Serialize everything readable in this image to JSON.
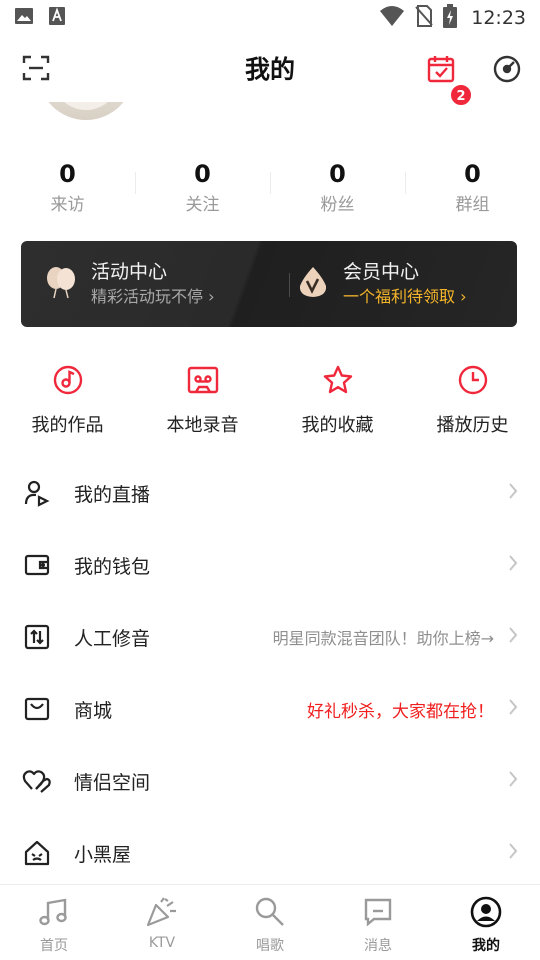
{
  "status_bar": {
    "time": "12:23"
  },
  "header": {
    "title": "我的",
    "calendar_badge": "2"
  },
  "stats": [
    {
      "value": "0",
      "label": "来访"
    },
    {
      "value": "0",
      "label": "关注"
    },
    {
      "value": "0",
      "label": "粉丝"
    },
    {
      "value": "0",
      "label": "群组"
    }
  ],
  "banner": {
    "activity": {
      "title": "活动中心",
      "subtitle": "精彩活动玩不停 ›"
    },
    "vip": {
      "title": "会员中心",
      "subtitle": "一个福利待领取 ›"
    }
  },
  "shortcuts": [
    {
      "label": "我的作品",
      "icon": "disc-icon"
    },
    {
      "label": "本地录音",
      "icon": "cassette-icon"
    },
    {
      "label": "我的收藏",
      "icon": "star-icon"
    },
    {
      "label": "播放历史",
      "icon": "clock-icon"
    }
  ],
  "menu": [
    {
      "label": "我的直播",
      "hint": "",
      "icon": "live-user-icon"
    },
    {
      "label": "我的钱包",
      "hint": "",
      "icon": "wallet-icon"
    },
    {
      "label": "人工修音",
      "hint": "明星同款混音团队！助你上榜→",
      "icon": "tuning-icon"
    },
    {
      "label": "商城",
      "hint": "好礼秒杀，大家都在抢！",
      "icon": "shopping-bag-icon"
    },
    {
      "label": "情侣空间",
      "hint": "",
      "icon": "couple-hearts-icon"
    },
    {
      "label": "小黑屋",
      "hint": "",
      "icon": "house-icon"
    }
  ],
  "tabbar": [
    {
      "label": "首页",
      "icon": "music-note-icon",
      "active": false
    },
    {
      "label": "KTV",
      "icon": "party-popper-icon",
      "active": false
    },
    {
      "label": "唱歌",
      "icon": "microphone-icon",
      "active": false
    },
    {
      "label": "消息",
      "icon": "message-icon",
      "active": false
    },
    {
      "label": "我的",
      "icon": "profile-icon",
      "active": true
    }
  ],
  "colors": {
    "accent_red": "#f0283c",
    "hint_red": "#f01e1e",
    "gold": "#f5b52a",
    "banner_dark": "#2a2a2a"
  }
}
